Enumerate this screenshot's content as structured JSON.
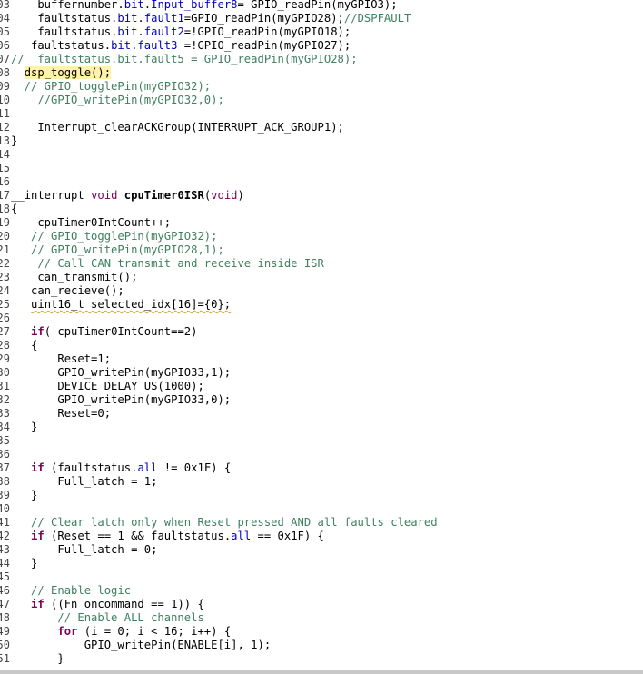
{
  "editor": {
    "lines": [
      {
        "n": "03",
        "segs": [
          [
            "",
            "    buffernumber."
          ],
          [
            "field",
            "bit"
          ],
          [
            "",
            "."
          ],
          [
            "field",
            "Input_buffer8"
          ],
          [
            "",
            "= GPIO_readPin(myGPIO3);"
          ]
        ]
      },
      {
        "n": "04",
        "segs": [
          [
            "",
            "    faultstatus."
          ],
          [
            "field",
            "bit"
          ],
          [
            "",
            "."
          ],
          [
            "field",
            "fault1"
          ],
          [
            "",
            "=GPIO_readPin(myGPIO28);"
          ],
          [
            "cm",
            "//DSPFAULT"
          ]
        ]
      },
      {
        "n": "05",
        "segs": [
          [
            "",
            "    faultstatus."
          ],
          [
            "field",
            "bit"
          ],
          [
            "",
            "."
          ],
          [
            "field",
            "fault2"
          ],
          [
            "",
            "=!GPIO_readPin(myGPIO18);"
          ]
        ]
      },
      {
        "n": "06",
        "segs": [
          [
            "",
            "   faultstatus."
          ],
          [
            "field",
            "bit"
          ],
          [
            "",
            "."
          ],
          [
            "field",
            "fault3"
          ],
          [
            "",
            " =!GPIO_readPin(myGPIO27);"
          ]
        ]
      },
      {
        "n": "07",
        "segs": [
          [
            "cm",
            "//  faultstatus.bit.fault5 = GPIO_readPin(myGPIO28);"
          ]
        ]
      },
      {
        "n": "08",
        "segs": [
          [
            "",
            "  "
          ],
          [
            "hl",
            "dsp_toggle();"
          ]
        ]
      },
      {
        "n": "09",
        "segs": [
          [
            "cm",
            "  // GPIO_togglePin(myGPIO32);"
          ]
        ]
      },
      {
        "n": "10",
        "segs": [
          [
            "cm",
            "    //GPIO_writePin(myGPIO32,0);"
          ]
        ]
      },
      {
        "n": "11",
        "segs": [
          [
            "",
            ""
          ]
        ]
      },
      {
        "n": "12",
        "segs": [
          [
            "",
            "    Interrupt_clearACKGroup(INTERRUPT_ACK_GROUP1);"
          ]
        ]
      },
      {
        "n": "13",
        "segs": [
          [
            "",
            "}"
          ]
        ]
      },
      {
        "n": "14",
        "segs": [
          [
            "",
            ""
          ]
        ]
      },
      {
        "n": "15",
        "segs": [
          [
            "",
            ""
          ]
        ]
      },
      {
        "n": "16",
        "segs": [
          [
            "",
            ""
          ]
        ]
      },
      {
        "n": "17",
        "segs": [
          [
            "",
            "__interrupt "
          ],
          [
            "kw2",
            "void"
          ],
          [
            "",
            " "
          ],
          [
            "fn-bold",
            "cpuTimer0ISR"
          ],
          [
            "",
            "("
          ],
          [
            "kw2",
            "void"
          ],
          [
            "",
            ")"
          ]
        ]
      },
      {
        "n": "18",
        "segs": [
          [
            "",
            "{"
          ]
        ]
      },
      {
        "n": "19",
        "segs": [
          [
            "",
            "    cpuTimer0IntCount++;"
          ]
        ]
      },
      {
        "n": "20",
        "segs": [
          [
            "cm",
            "   // GPIO_togglePin(myGPIO32);"
          ]
        ]
      },
      {
        "n": "21",
        "segs": [
          [
            "cm",
            "   // GPIO_writePin(myGPIO28,1);"
          ]
        ]
      },
      {
        "n": "22",
        "segs": [
          [
            "cm",
            "    // Call CAN transmit and receive inside ISR"
          ]
        ]
      },
      {
        "n": "23",
        "segs": [
          [
            "",
            "    can_transmit();"
          ]
        ]
      },
      {
        "n": "24",
        "segs": [
          [
            "",
            "   can_recieve();"
          ]
        ]
      },
      {
        "n": "25",
        "segs": [
          [
            "",
            "   "
          ],
          [
            "squig",
            "uint16_t selected_idx[16]={0};"
          ]
        ]
      },
      {
        "n": "26",
        "segs": [
          [
            "",
            ""
          ]
        ]
      },
      {
        "n": "27",
        "segs": [
          [
            "",
            "   "
          ],
          [
            "kw",
            "if"
          ],
          [
            "",
            "( cpuTimer0IntCount==2)"
          ]
        ]
      },
      {
        "n": "28",
        "segs": [
          [
            "",
            "   {"
          ]
        ]
      },
      {
        "n": "29",
        "segs": [
          [
            "",
            "       Reset=1;"
          ]
        ]
      },
      {
        "n": "30",
        "segs": [
          [
            "",
            "       GPIO_writePin(myGPIO33,1);"
          ]
        ]
      },
      {
        "n": "31",
        "segs": [
          [
            "",
            "       DEVICE_DELAY_US(1000);"
          ]
        ]
      },
      {
        "n": "32",
        "segs": [
          [
            "",
            "       GPIO_writePin(myGPIO33,0);"
          ]
        ]
      },
      {
        "n": "33",
        "segs": [
          [
            "",
            "       Reset=0;"
          ]
        ]
      },
      {
        "n": "34",
        "segs": [
          [
            "",
            "   }"
          ]
        ]
      },
      {
        "n": "35",
        "segs": [
          [
            "",
            ""
          ]
        ]
      },
      {
        "n": "36",
        "segs": [
          [
            "",
            ""
          ]
        ]
      },
      {
        "n": "37",
        "segs": [
          [
            "",
            "   "
          ],
          [
            "kw",
            "if"
          ],
          [
            "",
            " (faultstatus."
          ],
          [
            "field",
            "all"
          ],
          [
            "",
            " != 0x1F) {"
          ]
        ]
      },
      {
        "n": "38",
        "segs": [
          [
            "",
            "       Full_latch = 1;"
          ]
        ]
      },
      {
        "n": "39",
        "segs": [
          [
            "",
            "   }"
          ]
        ]
      },
      {
        "n": "40",
        "segs": [
          [
            "",
            ""
          ]
        ]
      },
      {
        "n": "41",
        "segs": [
          [
            "cm",
            "   // Clear latch only when Reset pressed AND all faults cleared"
          ]
        ]
      },
      {
        "n": "42",
        "segs": [
          [
            "",
            "   "
          ],
          [
            "kw",
            "if"
          ],
          [
            "",
            " (Reset == 1 && faultstatus."
          ],
          [
            "field",
            "all"
          ],
          [
            "",
            " == 0x1F) {"
          ]
        ]
      },
      {
        "n": "43",
        "segs": [
          [
            "",
            "       Full_latch = 0;"
          ]
        ]
      },
      {
        "n": "44",
        "segs": [
          [
            "",
            "   }"
          ]
        ]
      },
      {
        "n": "45",
        "segs": [
          [
            "",
            ""
          ]
        ]
      },
      {
        "n": "46",
        "segs": [
          [
            "cm",
            "   // Enable logic"
          ]
        ]
      },
      {
        "n": "47",
        "segs": [
          [
            "",
            "   "
          ],
          [
            "kw",
            "if"
          ],
          [
            "",
            " ((Fn_oncommand == 1)) {"
          ]
        ]
      },
      {
        "n": "48",
        "segs": [
          [
            "cm",
            "       // Enable ALL channels"
          ]
        ]
      },
      {
        "n": "49",
        "segs": [
          [
            "",
            "       "
          ],
          [
            "kw",
            "for"
          ],
          [
            "",
            " (i = 0; i < 16; i++) {"
          ]
        ]
      },
      {
        "n": "50",
        "segs": [
          [
            "",
            "           GPIO_writePin(ENABLE[i], 1);"
          ]
        ]
      },
      {
        "n": "51",
        "segs": [
          [
            "",
            "       }"
          ]
        ]
      }
    ]
  }
}
